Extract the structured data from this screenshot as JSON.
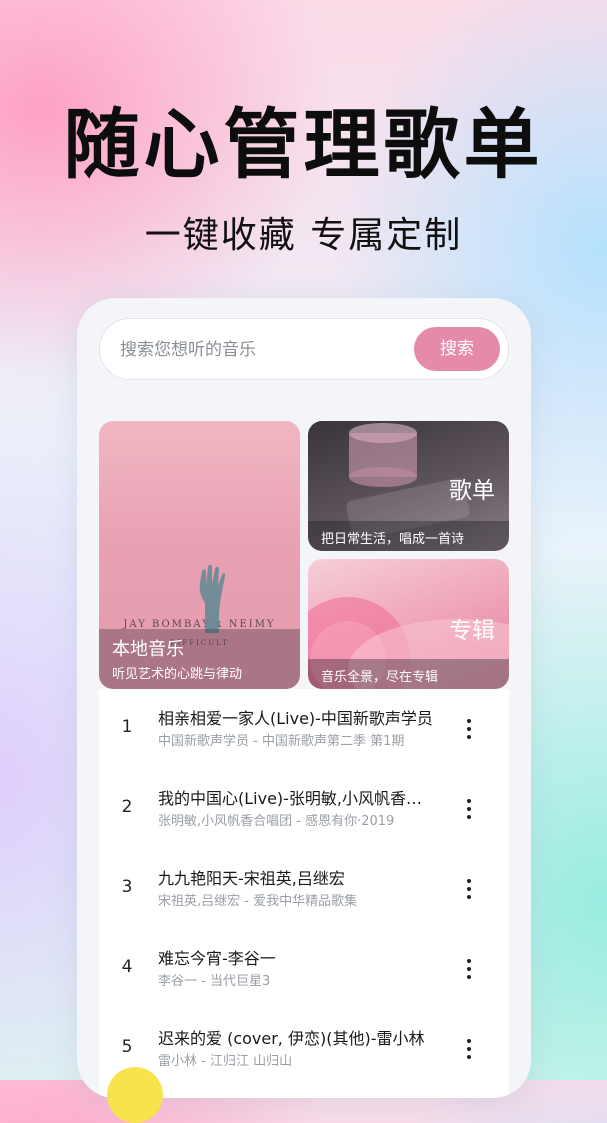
{
  "promo": {
    "headline": "随心管理歌单",
    "subline": "一键收藏 专属定制"
  },
  "search": {
    "placeholder": "搜索您想听的音乐",
    "button_label": "搜索"
  },
  "cards": {
    "local": {
      "title": "本地音乐",
      "subtitle": "听见艺术的心跳与律动",
      "art_text_1": "JAY BOMBAY x NEIMY",
      "art_text_2": "DIFFICULT"
    },
    "playlist": {
      "title": "歌单",
      "subtitle": "把日常生活，唱成一首诗"
    },
    "album": {
      "title": "专辑",
      "subtitle": "音乐全景，尽在专辑"
    }
  },
  "songs": [
    {
      "num": "1",
      "title": "相亲相爱一家人(Live)-中国新歌声学员",
      "subtitle": "中国新歌声学员 - 中国新歌声第二季 第1期"
    },
    {
      "num": "2",
      "title": "我的中国心(Live)-张明敏,小风帆香合唱团",
      "subtitle": "张明敏,小风帆香合唱团 - 感恩有你·2019"
    },
    {
      "num": "3",
      "title": "九九艳阳天-宋祖英,吕继宏",
      "subtitle": "宋祖英,吕继宏 - 爱我中华精品歌集"
    },
    {
      "num": "4",
      "title": "难忘今宵-李谷一",
      "subtitle": "李谷一 - 当代巨星3"
    },
    {
      "num": "5",
      "title": "迟来的爱 (cover, 伊恋)(其他)-雷小林",
      "subtitle": "雷小林 - 江归江   山归山"
    }
  ],
  "colors": {
    "accent": "#e58aaa",
    "card_background": "#f3f5f8"
  }
}
